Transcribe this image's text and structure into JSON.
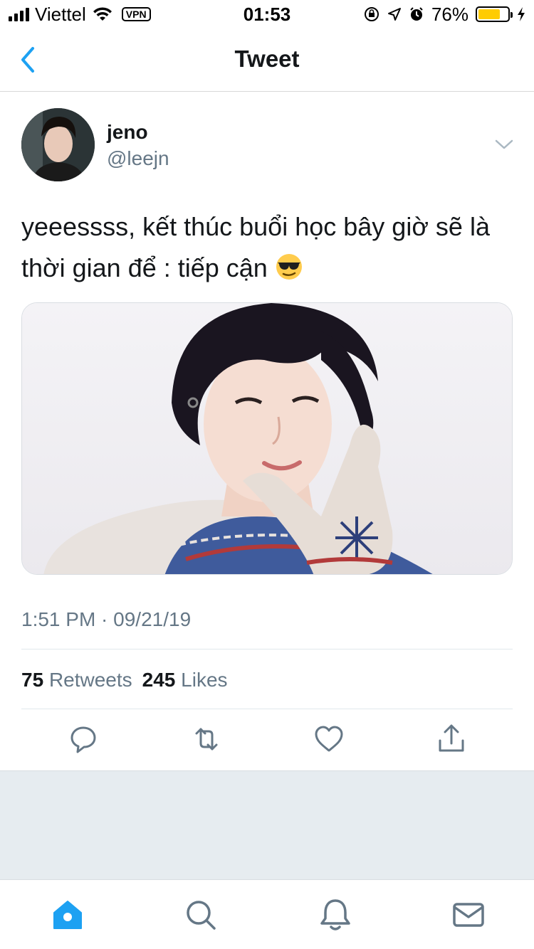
{
  "status_bar": {
    "carrier": "Viettel",
    "vpn": "VPN",
    "time": "01:53",
    "battery_percent": "76%",
    "battery_level": 0.76
  },
  "nav": {
    "title": "Tweet",
    "back_icon": "chevron-left-icon"
  },
  "tweet": {
    "name": "jeno",
    "handle": "@leejn",
    "text": "yeeessss, kết thúc buổi học bây giờ sẽ là thời gian để : tiếp cận",
    "emoji": "smiling-face-with-sunglasses",
    "timestamp": "1:51 PM · 09/21/19",
    "retweets_count": "75",
    "retweets_label": "Retweets",
    "likes_count": "245",
    "likes_label": "Likes"
  },
  "actions": [
    "reply-icon",
    "retweet-icon",
    "like-icon",
    "share-icon"
  ],
  "tabs": [
    "home-icon",
    "search-icon",
    "notifications-icon",
    "messages-icon"
  ],
  "colors": {
    "accent": "#1da1f2",
    "text_primary": "#14171a",
    "text_secondary": "#657786",
    "battery": "#ffcc00",
    "background_gray": "#e6ecf0"
  }
}
